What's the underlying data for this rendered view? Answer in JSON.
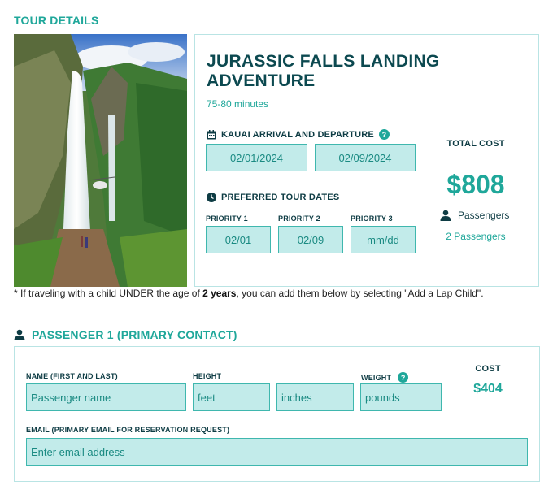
{
  "section_title": "TOUR DETAILS",
  "tour": {
    "name": "JURASSIC FALLS LANDING ADVENTURE",
    "duration": "75-80 minutes",
    "arrival_heading": "KAUAI ARRIVAL AND DEPARTURE",
    "arrival_date": "02/01/2024",
    "departure_date": "02/09/2024",
    "preferred_heading": "PREFERRED TOUR DATES",
    "priorities": [
      {
        "label": "PRIORITY 1",
        "value": "02/01"
      },
      {
        "label": "PRIORITY 2",
        "value": "02/09"
      },
      {
        "label": "PRIORITY 3",
        "value": "mm/dd"
      }
    ],
    "total_cost_label": "TOTAL COST",
    "total_cost": "$808",
    "passengers_label": "Passengers",
    "passengers_link": "2 Passengers"
  },
  "note": {
    "prefix": "* If traveling with a child UNDER the age of ",
    "bold": "2 years",
    "suffix": ", you can add them below by selecting \"Add a Lap Child\"."
  },
  "passenger": {
    "heading": "PASSENGER 1 (PRIMARY CONTACT)",
    "name_label": "NAME (FIRST AND LAST)",
    "name_placeholder": "Passenger name",
    "height_label": "HEIGHT",
    "feet_placeholder": "feet",
    "inches_placeholder": "inches",
    "weight_label": "WEIGHT",
    "weight_placeholder": "pounds",
    "cost_label": "COST",
    "cost_value": "$404",
    "email_label": "EMAIL (PRIMARY EMAIL FOR RESERVATION REQUEST)",
    "email_placeholder": "Enter email address"
  },
  "icons": {
    "calendar": "calendar-icon",
    "help": "help-icon",
    "clock": "clock-icon",
    "person": "person-icon"
  },
  "colors": {
    "accent": "#1fa79a",
    "field_bg": "#c2ebea",
    "heading": "#0c4950"
  }
}
